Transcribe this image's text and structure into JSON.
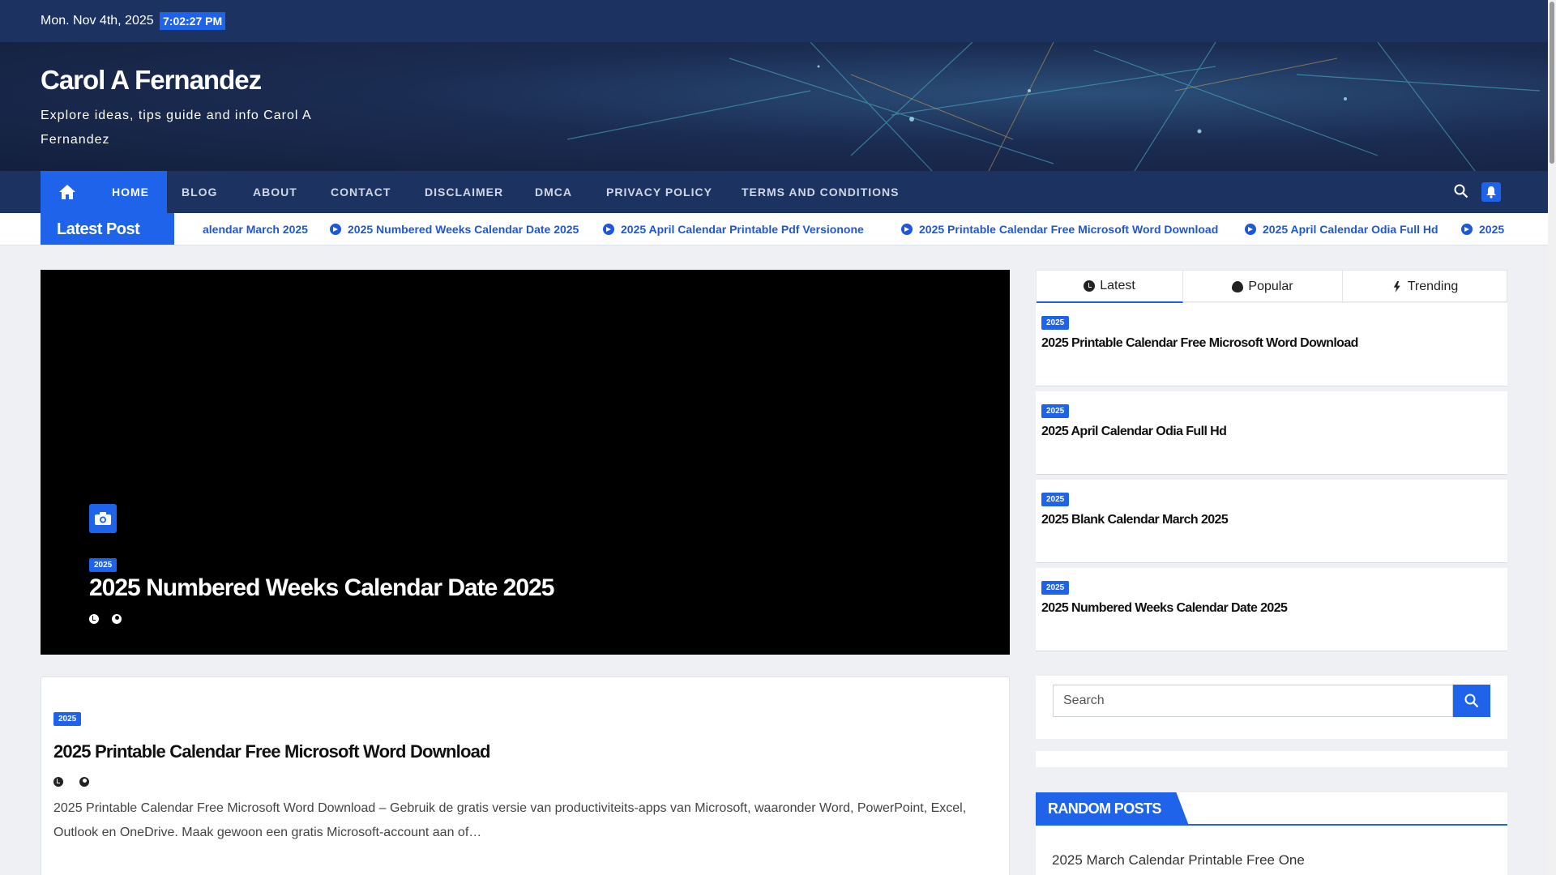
{
  "topbar": {
    "date": "Mon. Nov 4th, 2025",
    "time": "7:02:27 PM"
  },
  "header": {
    "site_title": "Carol A Fernandez",
    "site_description": "Explore ideas, tips guide and info Carol A Fernandez"
  },
  "nav": {
    "home_icon": "home-icon",
    "items": [
      {
        "label": "Home",
        "active": true
      },
      {
        "label": "Blog"
      },
      {
        "label": "About"
      },
      {
        "label": "Contact"
      },
      {
        "label": "Disclaimer"
      },
      {
        "label": "DMCA"
      },
      {
        "label": "Privacy Policy"
      },
      {
        "label": "Terms and Conditions"
      }
    ]
  },
  "ticker": {
    "label": "Latest Post",
    "items": [
      "alendar March 2025",
      "2025 Numbered Weeks Calendar Date 2025",
      "2025 April Calendar Printable Pdf Versionone",
      "2025 Printable Calendar Free Microsoft Word Download",
      "2025 April Calendar Odia Full Hd",
      "2025"
    ]
  },
  "hero": {
    "badge": "2025",
    "title": "2025 Numbered Weeks Calendar Date 2025"
  },
  "article": {
    "badge": "2025",
    "title": "2025 Printable Calendar Free Microsoft Word Download",
    "excerpt": "2025 Printable Calendar Free Microsoft Word Download – Gebruik de gratis versie van productiviteits-apps van Microsoft, waaronder Word, PowerPoint, Excel, Outlook en OneDrive. Maak gewoon een gratis Microsoft-account aan of…"
  },
  "sidebar": {
    "tabs": [
      {
        "label": "Latest",
        "icon": "clock-icon",
        "active": true
      },
      {
        "label": "Popular",
        "icon": "flame-icon"
      },
      {
        "label": "Trending",
        "icon": "bolt-icon"
      }
    ],
    "posts": [
      {
        "badge": "2025",
        "title": "2025 Printable Calendar Free Microsoft Word Download"
      },
      {
        "badge": "2025",
        "title": "2025 April Calendar Odia Full Hd"
      },
      {
        "badge": "2025",
        "title": "2025 Blank Calendar March 2025"
      },
      {
        "badge": "2025",
        "title": "2025 Numbered Weeks Calendar Date 2025"
      }
    ],
    "search_placeholder": "Search",
    "random_heading": "RANDOM POSTS",
    "random_posts": [
      "2025 March Calendar Printable Free One"
    ]
  },
  "colors": {
    "accent": "#1e63e9",
    "nav_bg": "#1c3260"
  }
}
